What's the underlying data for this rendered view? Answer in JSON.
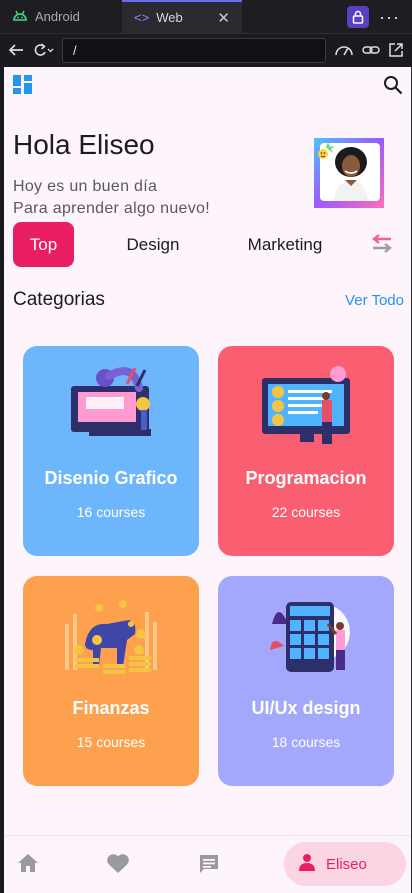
{
  "browser": {
    "tabs": [
      {
        "label": "Android",
        "icon": "android-icon"
      },
      {
        "label": "Web",
        "icon": "code-icon",
        "active": true
      }
    ],
    "address": "/"
  },
  "app": {
    "greeting": "Hola Eliseo",
    "subtitle_line1": "Hoy es un buen día",
    "subtitle_line2": "Para aprender algo nuevo!",
    "chips": [
      "Top",
      "Design",
      "Marketing"
    ],
    "section_title": "Categorias",
    "see_all": "Ver Todo",
    "categories": [
      {
        "title": "Disenio Grafico",
        "count": "16 courses",
        "color": "#6eb6fc"
      },
      {
        "title": "Programacion",
        "count": "22 courses",
        "color": "#fa5f71"
      },
      {
        "title": "Finanzas",
        "count": "15 courses",
        "color": "#fea14f"
      },
      {
        "title": "UI/Ux design",
        "count": "18 courses",
        "color": "#a3a8fc"
      }
    ],
    "bottom_nav": {
      "items": [
        "home-icon",
        "heart-icon",
        "chat-icon"
      ],
      "profile_label": "Eliseo"
    },
    "colors": {
      "accent": "#ea1e63",
      "link": "#2196f3",
      "background": "#fdf4fc"
    }
  }
}
